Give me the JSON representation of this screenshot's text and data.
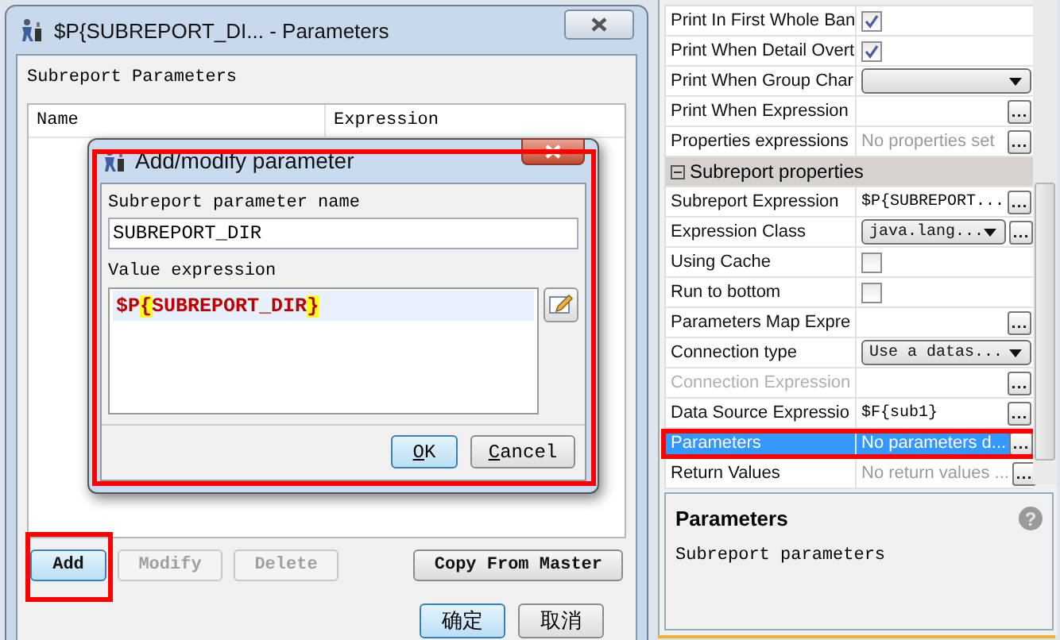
{
  "parameters_window": {
    "title": "$P{SUBREPORT_DI... - Parameters",
    "section_label": "Subreport Parameters",
    "table": {
      "columns": [
        "Name",
        "Expression"
      ]
    },
    "buttons": [
      {
        "label": "Add",
        "disabled": false,
        "highlighted": true
      },
      {
        "label": "Modify",
        "disabled": true,
        "highlighted": false
      },
      {
        "label": "Delete",
        "disabled": true,
        "highlighted": false
      },
      {
        "label": "Copy From Master",
        "disabled": false,
        "highlighted": false
      }
    ],
    "dialog_buttons": [
      {
        "label": "确定",
        "default": true
      },
      {
        "label": "取消",
        "default": false
      }
    ]
  },
  "add_modify_dialog": {
    "title": "Add/modify parameter",
    "highlighted": true,
    "name_label": "Subreport parameter name",
    "name_value": "SUBREPORT_DIR",
    "expression_label": "Value expression",
    "expression_tokens": [
      {
        "text": "$P",
        "kind": "variable"
      },
      {
        "text": "{",
        "kind": "brace"
      },
      {
        "text": "SUBREPORT_DIR",
        "kind": "variable"
      },
      {
        "text": "}",
        "kind": "brace"
      }
    ],
    "buttons": [
      {
        "label": "OK",
        "default": true,
        "mnemonic": true
      },
      {
        "label": "Cancel",
        "default": false,
        "mnemonic": true
      }
    ]
  },
  "property_sheet": {
    "rows": [
      {
        "kind": "checkbox",
        "label": "Print In First Whole Ban",
        "checked": true,
        "selected": false
      },
      {
        "kind": "checkbox",
        "label": "Print When Detail Overt",
        "checked": true,
        "selected": false
      },
      {
        "kind": "dropdown",
        "label": "Print When Group Char",
        "selected": false
      },
      {
        "kind": "editor",
        "label": "Print When Expression",
        "selected": false
      },
      {
        "kind": "editor",
        "label": "Properties expressions",
        "placeholder": "No properties set",
        "selected": false
      },
      {
        "kind": "section",
        "label": "Subreport properties",
        "expanded": true
      },
      {
        "kind": "expression",
        "label": "Subreport Expression",
        "value": "$P{SUBREPORT...",
        "selected": false
      },
      {
        "kind": "dropdown_editor",
        "label": "Expression Class",
        "value": "java.lang...",
        "selected": false
      },
      {
        "kind": "checkbox",
        "label": "Using Cache",
        "checked": false,
        "selected": false
      },
      {
        "kind": "checkbox",
        "label": "Run to bottom",
        "checked": false,
        "selected": false
      },
      {
        "kind": "editor",
        "label": "Parameters Map Expre",
        "selected": false
      },
      {
        "kind": "dropdown",
        "label": "Connection type",
        "value": "Use a datas...",
        "selected": false
      },
      {
        "kind": "editor",
        "label": "Connection Expression",
        "disabled": true,
        "selected": false
      },
      {
        "kind": "expression",
        "label": "Data Source Expressio",
        "value": "$F{sub1}",
        "selected": false
      },
      {
        "kind": "editor",
        "label": "Parameters",
        "value": "No parameters d...",
        "selected": true,
        "highlighted": true
      },
      {
        "kind": "editor",
        "label": "Return Values",
        "placeholder": "No return values ...",
        "selected": false
      }
    ],
    "help": {
      "title": "Parameters",
      "text": "Subreport parameters",
      "icon_glyph": "?"
    }
  }
}
